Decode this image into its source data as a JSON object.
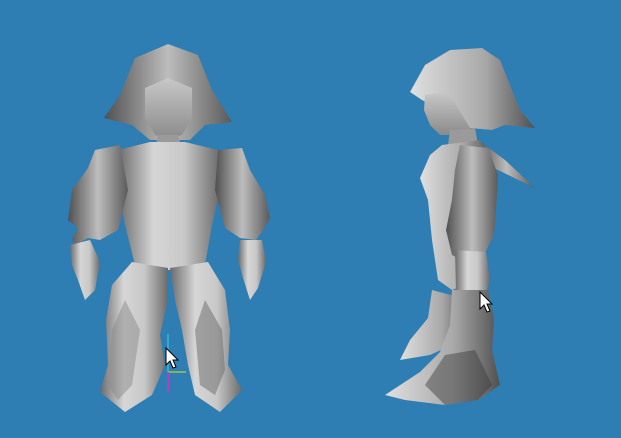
{
  "viewport": {
    "background_color": "#2e7db3",
    "model_color": "#b4b4b4",
    "model_shadow_color": "#4a4a4a",
    "views": [
      {
        "name": "front-view"
      },
      {
        "name": "side-view"
      }
    ]
  },
  "gizmo": {
    "x_axis_color": "#e6e600",
    "y_axis_color": "#33d9e6",
    "z_axis_color": "#b040c0"
  },
  "cursors": [
    {
      "icon": "mouse-cursor-icon"
    },
    {
      "icon": "mouse-cursor-icon"
    }
  ]
}
